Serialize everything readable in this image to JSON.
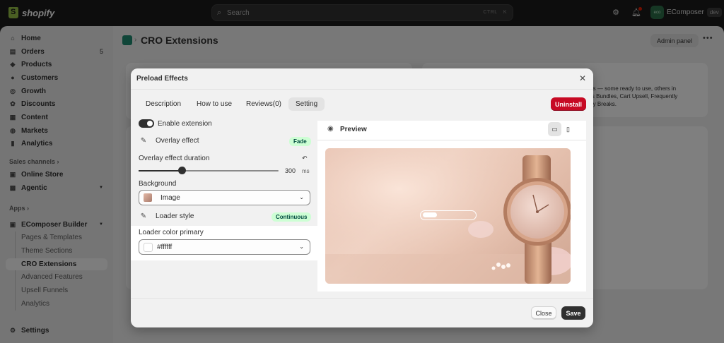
{
  "topbar": {
    "brand": "shopify",
    "search_placeholder": "Search",
    "shortcut": "CTRL K",
    "store_avatar": "eco",
    "store_name": "EComposer",
    "store_badge": "dev"
  },
  "sidebar": {
    "items": [
      {
        "label": "Home",
        "icon": "home-icon"
      },
      {
        "label": "Orders",
        "icon": "orders-icon",
        "count": "5"
      },
      {
        "label": "Products",
        "icon": "products-icon"
      },
      {
        "label": "Customers",
        "icon": "customers-icon"
      },
      {
        "label": "Growth",
        "icon": "growth-icon"
      },
      {
        "label": "Discounts",
        "icon": "discounts-icon"
      },
      {
        "label": "Content",
        "icon": "content-icon"
      },
      {
        "label": "Markets",
        "icon": "markets-icon"
      },
      {
        "label": "Analytics",
        "icon": "analytics-icon"
      }
    ],
    "sales_channels_label": "Sales channels",
    "channels": [
      {
        "label": "Online Store",
        "icon": "store-icon"
      },
      {
        "label": "Agentic",
        "icon": "agentic-icon"
      }
    ],
    "apps_label": "Apps",
    "app_name": "EComposer Builder",
    "app_subitems": [
      "Pages & Templates",
      "Theme Sections",
      "CRO Extensions",
      "Advanced Features",
      "Upsell Funnels",
      "Analytics"
    ],
    "active_subitem": "CRO Extensions",
    "settings_label": "Settings"
  },
  "page": {
    "title": "CRO Extensions",
    "admin_button": "Admin panel",
    "bg_text_lines": [
      "ions — some ready to use, others in",
      "des Bundles, Cart Upsell, Frequently",
      "ntity Breaks."
    ]
  },
  "modal": {
    "title": "Preload Effects",
    "tabs": [
      "Description",
      "How to use",
      "Reviews(0)",
      "Setting"
    ],
    "active_tab": "Setting",
    "uninstall_label": "Uninstall",
    "enable_label": "Enable extension",
    "enable_on": true,
    "overlay_effect_label": "Overlay effect",
    "overlay_effect_value": "Fade",
    "duration_label": "Overlay effect duration",
    "duration_value": "300",
    "duration_unit": "ms",
    "duration_fraction": 0.31,
    "background_label": "Background",
    "background_value": "Image",
    "loader_style_label": "Loader style",
    "loader_style_value": "Continuous",
    "loader_color_label": "Loader color primary",
    "loader_color_value": "#ffffff",
    "preview_label": "Preview",
    "close_label": "Close",
    "save_label": "Save"
  },
  "colors": {
    "accent_danger": "#c70a24",
    "success_badge_bg": "#cdfed4",
    "success_badge_text": "#014b40",
    "primary_button": "#303030"
  }
}
